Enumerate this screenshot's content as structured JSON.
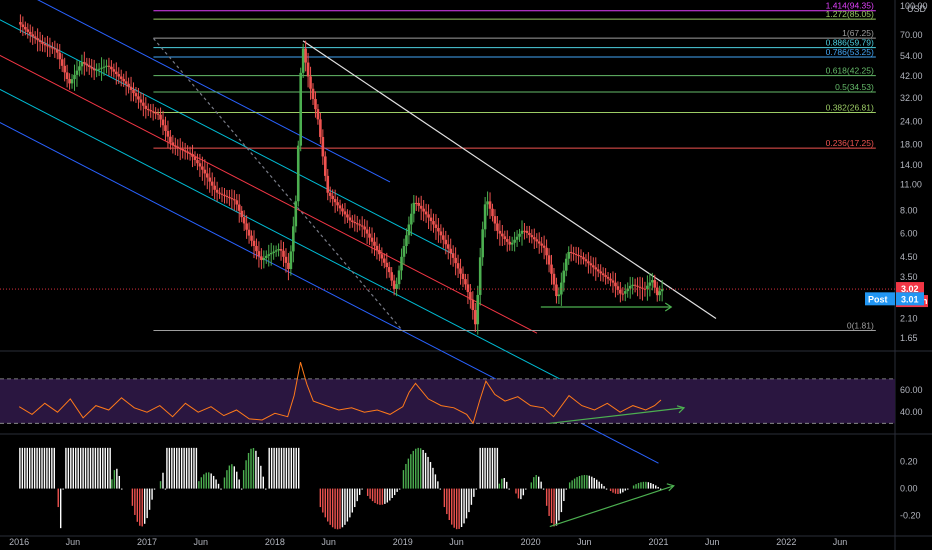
{
  "chart_data": [
    {
      "type": "candlestick",
      "currency": "USD",
      "scale": "log",
      "x_tick_labels": [
        "2016",
        "Jun",
        "2017",
        "Jun",
        "2018",
        "Jun",
        "2019",
        "Jun",
        "2020",
        "Jun",
        "2021",
        "Jun",
        "2022",
        "Jun"
      ],
      "price_tick_labels": [
        "100.00",
        "70.00",
        "54.00",
        "42.00",
        "32.00",
        "24.00",
        "18.00",
        "14.00",
        "11.00",
        "8.00",
        "6.00",
        "4.50",
        "3.50",
        "2.70",
        "2.10",
        "1.65"
      ],
      "ylim": [
        1.55,
        100
      ],
      "fib_levels": [
        {
          "label": "1.414(94.35)",
          "value": 94.35,
          "color": "#e040fb"
        },
        {
          "label": "1.272(85.05)",
          "value": 85.05,
          "color": "#9ccc65"
        },
        {
          "label": "1(67.25)",
          "value": 67.25,
          "color": "#9e9e9e"
        },
        {
          "label": "0.886(59.79)",
          "value": 59.79,
          "color": "#4dd0e1"
        },
        {
          "label": "0.786(53.25)",
          "value": 53.25,
          "color": "#42a5f5"
        },
        {
          "label": "0.618(42.25)",
          "value": 42.25,
          "color": "#66bb6a"
        },
        {
          "label": "0.5(34.53)",
          "value": 34.53,
          "color": "#66bb6a"
        },
        {
          "label": "0.382(26.81)",
          "value": 26.81,
          "color": "#9ccc65"
        },
        {
          "label": "0.236(17.25)",
          "value": 17.25,
          "color": "#ef5350"
        },
        {
          "label": "0(1.81)",
          "value": 1.81,
          "color": "#9e9e9e"
        }
      ],
      "last_price": {
        "label": "3.02",
        "value": 3.02,
        "color": "#f23645"
      },
      "countdown": {
        "label": "2d 21h",
        "color": "#f23645"
      },
      "post_market": {
        "label": "Post",
        "value_label": "3.01",
        "value": 3.01,
        "color": "#2196f3"
      },
      "price_path": [
        [
          2016.0,
          82
        ],
        [
          2016.1,
          70
        ],
        [
          2016.2,
          62
        ],
        [
          2016.3,
          58
        ],
        [
          2016.4,
          38
        ],
        [
          2016.5,
          50
        ],
        [
          2016.6,
          45
        ],
        [
          2016.7,
          48
        ],
        [
          2016.85,
          38
        ],
        [
          2017.0,
          28
        ],
        [
          2017.1,
          26
        ],
        [
          2017.2,
          18
        ],
        [
          2017.35,
          16
        ],
        [
          2017.45,
          13
        ],
        [
          2017.55,
          10
        ],
        [
          2017.7,
          9
        ],
        [
          2017.8,
          6
        ],
        [
          2017.9,
          4.3
        ],
        [
          2017.95,
          4.6
        ],
        [
          2018.05,
          5
        ],
        [
          2018.12,
          3.8
        ],
        [
          2018.18,
          10
        ],
        [
          2018.22,
          65
        ],
        [
          2018.28,
          38
        ],
        [
          2018.35,
          24
        ],
        [
          2018.42,
          10
        ],
        [
          2018.5,
          8.5
        ],
        [
          2018.6,
          7
        ],
        [
          2018.7,
          6.5
        ],
        [
          2018.8,
          5
        ],
        [
          2018.9,
          3.8
        ],
        [
          2018.95,
          2.9
        ],
        [
          2019.0,
          4.5
        ],
        [
          2019.1,
          9
        ],
        [
          2019.2,
          7.5
        ],
        [
          2019.3,
          6
        ],
        [
          2019.4,
          4.5
        ],
        [
          2019.5,
          3.2
        ],
        [
          2019.55,
          2.5
        ],
        [
          2019.58,
          1.9
        ],
        [
          2019.62,
          5
        ],
        [
          2019.66,
          9.5
        ],
        [
          2019.75,
          6.2
        ],
        [
          2019.85,
          5.2
        ],
        [
          2019.95,
          6.3
        ],
        [
          2020.05,
          5.5
        ],
        [
          2020.12,
          5
        ],
        [
          2020.18,
          3.5
        ],
        [
          2020.22,
          2.6
        ],
        [
          2020.3,
          4.8
        ],
        [
          2020.4,
          4.5
        ],
        [
          2020.55,
          3.7
        ],
        [
          2020.65,
          3.3
        ],
        [
          2020.72,
          2.8
        ],
        [
          2020.8,
          3.2
        ],
        [
          2020.9,
          3.0
        ],
        [
          2020.96,
          3.4
        ],
        [
          2021.0,
          2.8
        ],
        [
          2021.03,
          3.02
        ]
      ],
      "drawn_lines": [
        {
          "name": "downtrend-resistance",
          "points": [
            [
              2018.22,
              65
            ],
            [
              2021.45,
              2.1
            ]
          ],
          "color": "#e0e0e0"
        },
        {
          "name": "dashed-trend",
          "points": [
            [
              2017.05,
              67
            ],
            [
              2019.0,
              1.8
            ]
          ],
          "color": "#787b86",
          "dashed": true
        },
        {
          "name": "support-arrow",
          "points": [
            [
              2020.08,
              2.42
            ],
            [
              2021.1,
              2.42
            ]
          ],
          "color": "#4caf50"
        }
      ],
      "regression_channel": {
        "start": 2016.0,
        "end_per_line": [
          2018.9,
          2019.4,
          2020.05,
          2020.55,
          2021.0
        ],
        "line_colors": [
          "#2962ff",
          "#00bcd4",
          "#f23645",
          "#00bcd4",
          "#2962ff"
        ],
        "offsets": [
          0.93,
          0.44,
          0,
          -0.42,
          -0.83
        ],
        "mid_start_value": 48,
        "mid_end_value": 1.75,
        "mid_end_year": 2020.05
      }
    },
    {
      "type": "line",
      "name": "RSI",
      "y_tick_labels": [
        "60.00",
        "40.00"
      ],
      "ylim": [
        24,
        87
      ],
      "bands": [
        70,
        30
      ],
      "background": "#2a1640",
      "line_color": "#ff7a1a",
      "path": [
        [
          2016.0,
          45
        ],
        [
          2016.1,
          38
        ],
        [
          2016.2,
          48
        ],
        [
          2016.3,
          40
        ],
        [
          2016.4,
          52
        ],
        [
          2016.5,
          35
        ],
        [
          2016.6,
          46
        ],
        [
          2016.7,
          42
        ],
        [
          2016.8,
          53
        ],
        [
          2016.9,
          44
        ],
        [
          2017.0,
          40
        ],
        [
          2017.1,
          46
        ],
        [
          2017.2,
          36
        ],
        [
          2017.3,
          48
        ],
        [
          2017.4,
          40
        ],
        [
          2017.5,
          45
        ],
        [
          2017.6,
          37
        ],
        [
          2017.7,
          42
        ],
        [
          2017.8,
          34
        ],
        [
          2017.9,
          33
        ],
        [
          2018.0,
          39
        ],
        [
          2018.1,
          36
        ],
        [
          2018.15,
          55
        ],
        [
          2018.2,
          85
        ],
        [
          2018.25,
          65
        ],
        [
          2018.3,
          50
        ],
        [
          2018.4,
          46
        ],
        [
          2018.5,
          42
        ],
        [
          2018.6,
          44
        ],
        [
          2018.7,
          40
        ],
        [
          2018.8,
          42
        ],
        [
          2018.9,
          38
        ],
        [
          2019.0,
          45
        ],
        [
          2019.05,
          58
        ],
        [
          2019.1,
          66
        ],
        [
          2019.2,
          52
        ],
        [
          2019.3,
          46
        ],
        [
          2019.4,
          44
        ],
        [
          2019.5,
          38
        ],
        [
          2019.55,
          30
        ],
        [
          2019.6,
          50
        ],
        [
          2019.65,
          68
        ],
        [
          2019.72,
          56
        ],
        [
          2019.8,
          50
        ],
        [
          2019.9,
          54
        ],
        [
          2020.0,
          46
        ],
        [
          2020.1,
          44
        ],
        [
          2020.18,
          36
        ],
        [
          2020.3,
          55
        ],
        [
          2020.4,
          46
        ],
        [
          2020.5,
          42
        ],
        [
          2020.6,
          48
        ],
        [
          2020.7,
          40
        ],
        [
          2020.8,
          46
        ],
        [
          2020.9,
          42
        ],
        [
          2020.97,
          46
        ],
        [
          2021.02,
          51
        ]
      ],
      "divergence_arrow": [
        [
          2020.15,
          30
        ],
        [
          2021.2,
          44
        ]
      ],
      "arrow_color": "#4caf50"
    },
    {
      "type": "bar",
      "name": "oscillator",
      "y_tick_labels": [
        "0.20",
        "0.00",
        "-0.20"
      ],
      "ylim": [
        -0.32,
        0.38
      ],
      "colors": {
        "strong_up": "#4caf50",
        "weak_up": "#ffffff",
        "weak_down": "#ef5350",
        "strong_down": "#ffffff"
      },
      "segments": [
        {
          "start": 2016.0,
          "end": 2016.28,
          "peak": 0.3,
          "sign": "up-flat"
        },
        {
          "start": 2016.3,
          "end": 2016.36,
          "peak": -0.3,
          "sign": "down"
        },
        {
          "start": 2016.36,
          "end": 2016.72,
          "peak": 0.3,
          "sign": "up-flat"
        },
        {
          "start": 2016.72,
          "end": 2016.82,
          "peak": 0.15,
          "sign": "up"
        },
        {
          "start": 2016.88,
          "end": 2017.08,
          "peak": -0.28,
          "sign": "down"
        },
        {
          "start": 2017.1,
          "end": 2017.15,
          "peak": 0.12,
          "sign": "up"
        },
        {
          "start": 2017.15,
          "end": 2017.4,
          "peak": 0.3,
          "sign": "up-flat"
        },
        {
          "start": 2017.4,
          "end": 2017.6,
          "peak": 0.12,
          "sign": "up"
        },
        {
          "start": 2017.6,
          "end": 2017.75,
          "peak": 0.18,
          "sign": "up"
        },
        {
          "start": 2017.75,
          "end": 2017.95,
          "peak": 0.3,
          "sign": "up"
        },
        {
          "start": 2017.95,
          "end": 2018.2,
          "peak": 0.3,
          "sign": "up-flat"
        },
        {
          "start": 2018.35,
          "end": 2018.7,
          "peak": -0.3,
          "sign": "down"
        },
        {
          "start": 2018.72,
          "end": 2018.98,
          "peak": -0.12,
          "sign": "down"
        },
        {
          "start": 2019.0,
          "end": 2019.3,
          "peak": 0.3,
          "sign": "up"
        },
        {
          "start": 2019.32,
          "end": 2019.58,
          "peak": -0.3,
          "sign": "down"
        },
        {
          "start": 2019.6,
          "end": 2019.75,
          "peak": 0.3,
          "sign": "up-flat"
        },
        {
          "start": 2019.75,
          "end": 2019.85,
          "peak": 0.08,
          "sign": "up"
        },
        {
          "start": 2019.88,
          "end": 2019.98,
          "peak": -0.08,
          "sign": "down"
        },
        {
          "start": 2020.0,
          "end": 2020.12,
          "peak": 0.1,
          "sign": "up"
        },
        {
          "start": 2020.12,
          "end": 2020.3,
          "peak": -0.28,
          "sign": "down"
        },
        {
          "start": 2020.3,
          "end": 2020.6,
          "peak": 0.1,
          "sign": "up"
        },
        {
          "start": 2020.62,
          "end": 2020.78,
          "peak": -0.04,
          "sign": "down"
        },
        {
          "start": 2020.8,
          "end": 2021.03,
          "peak": 0.05,
          "sign": "up"
        }
      ],
      "divergence_arrow": [
        [
          2020.15,
          -0.28
        ],
        [
          2021.12,
          0.02
        ]
      ],
      "arrow_color": "#4caf50"
    }
  ]
}
